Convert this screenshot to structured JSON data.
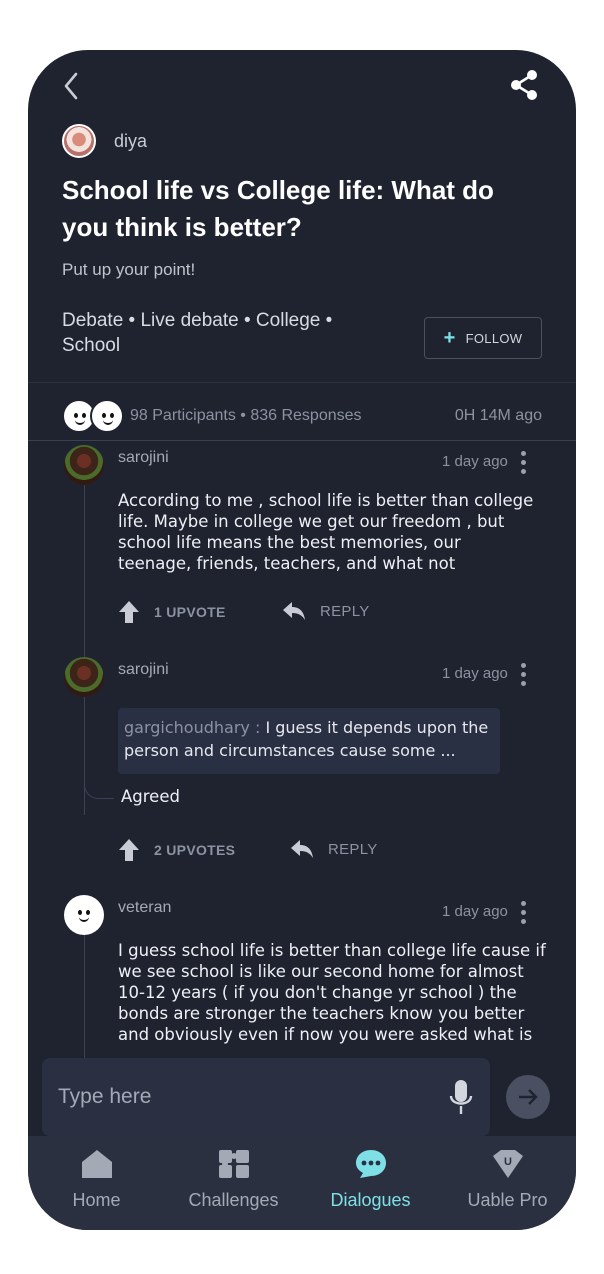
{
  "author": {
    "name": "diya"
  },
  "post": {
    "title": "School life vs College life: What do you think is better?",
    "subtitle": "Put up your point!",
    "tags": "Debate • Live debate • College • School",
    "follow_label": "FOLLOW"
  },
  "stats": {
    "summary": "98 Participants • 836 Responses",
    "time": "0H 14M ago"
  },
  "comments": [
    {
      "user": "sarojini",
      "time": "1 day ago",
      "body": "According to me , school life is better than college life. Maybe in college we get our freedom , but school life means the best memories, our teenage, friends, teachers, and what not",
      "upvotes": "1 UPVOTE",
      "reply_label": "REPLY"
    },
    {
      "user": "sarojini",
      "time": "1 day ago",
      "quote_user": "gargichoudhary :",
      "quote_text": "I guess it depends upon the person and circumstances cause some ...",
      "body": "Agreed",
      "upvotes": "2 UPVOTES",
      "reply_label": "REPLY"
    },
    {
      "user": "veteran",
      "time": "1 day ago",
      "body": "I guess school life is better than college life cause if we see school is like our second home for almost 10-12 years ( if you don't change yr school ) the bonds are stronger the teachers know you better and obviously even if now you were asked what is"
    }
  ],
  "input": {
    "placeholder": "Type here"
  },
  "nav": {
    "items": [
      {
        "label": "Home",
        "icon": "home-icon"
      },
      {
        "label": "Challenges",
        "icon": "puzzle-icon"
      },
      {
        "label": "Dialogues",
        "icon": "chat-bubble-icon",
        "active": true
      },
      {
        "label": "Uable Pro",
        "icon": "uable-badge-icon"
      }
    ]
  },
  "colors": {
    "background": "#1f2330",
    "accent": "#7ee0e6",
    "surface": "#2a3042"
  }
}
